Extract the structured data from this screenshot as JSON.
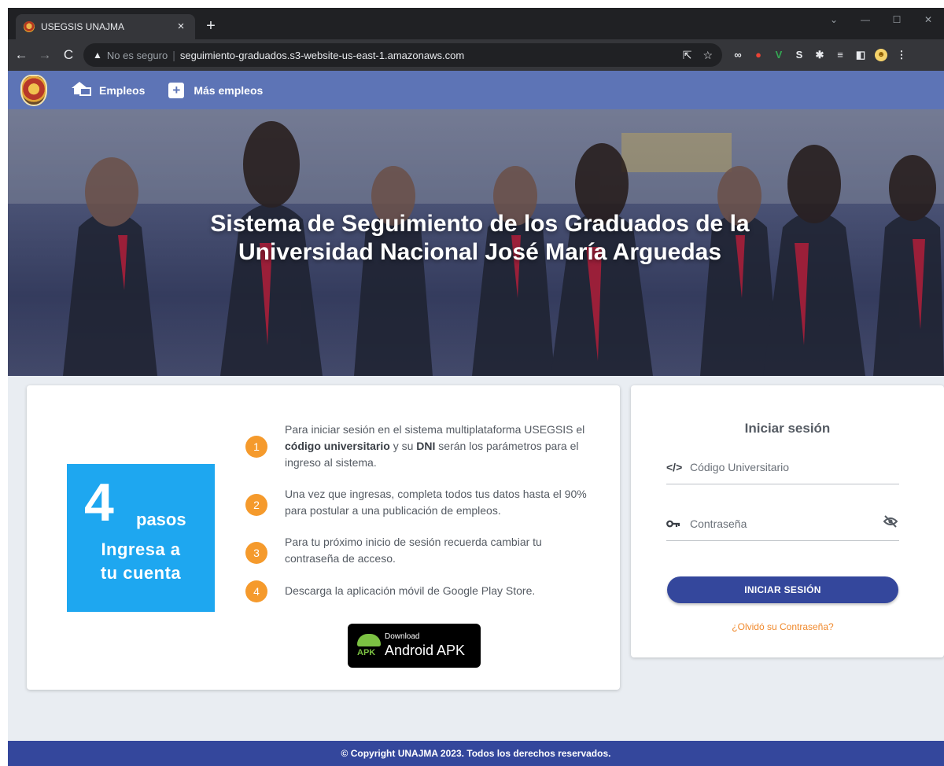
{
  "browser": {
    "tab_title": "USEGSIS UNAJMA",
    "tab_close": "×",
    "new_tab": "+",
    "security_label": "No es seguro",
    "url": "seguimiento-graduados.s3-website-us-east-1.amazonaws.com"
  },
  "sitenav": {
    "empleos_label": "Empleos",
    "mas_empleos_label": "Más empleos"
  },
  "hero": {
    "title_line1": "Sistema de Seguimiento de los Graduados de la",
    "title_line2": "Universidad Nacional José María Arguedas"
  },
  "promo": {
    "number": "4",
    "pasos": "pasos",
    "line1": "Ingresa a",
    "line2": "tu cuenta"
  },
  "steps": [
    {
      "num": "1",
      "text_a": "Para iniciar sesión en el sistema multiplataforma USEGSIS el ",
      "bold_a": "código universitario",
      "text_b": " y su ",
      "bold_b": "DNI",
      "text_c": " serán los parámetros para el ingreso al sistema."
    },
    {
      "num": "2",
      "text": "Una vez que ingresas, completa todos tus datos hasta el 90% para postular a una publicación de empleos."
    },
    {
      "num": "3",
      "text": "Para tu próximo inicio de sesión recuerda cambiar tu contraseña de acceso."
    },
    {
      "num": "4",
      "text": "Descarga la aplicación móvil de Google Play Store."
    }
  ],
  "apk_button": {
    "small": "Download",
    "big": "Android APK",
    "badge": "APK"
  },
  "login": {
    "title": "Iniciar sesión",
    "code_icon": "</>",
    "code_placeholder": "Código Universitario",
    "password_placeholder": "Contraseña",
    "submit_label": "INICIAR SESIÓN",
    "forgot_label": "¿Olvidó su Contraseña?"
  },
  "footer": {
    "copyright": "© Copyright UNAJMA 2023. Todos los derechos reservados."
  },
  "colors": {
    "nav_blue": "#5d74b6",
    "primary_blue": "#34479c",
    "promo_blue": "#1ea7f0",
    "step_orange": "#f59a2c",
    "link_orange": "#f0892c"
  },
  "icons": {
    "warning": "warning-icon",
    "home": "home-icon",
    "plus": "plus-icon",
    "code": "code-icon",
    "key": "key-icon",
    "eye_off": "eye-off-icon"
  }
}
